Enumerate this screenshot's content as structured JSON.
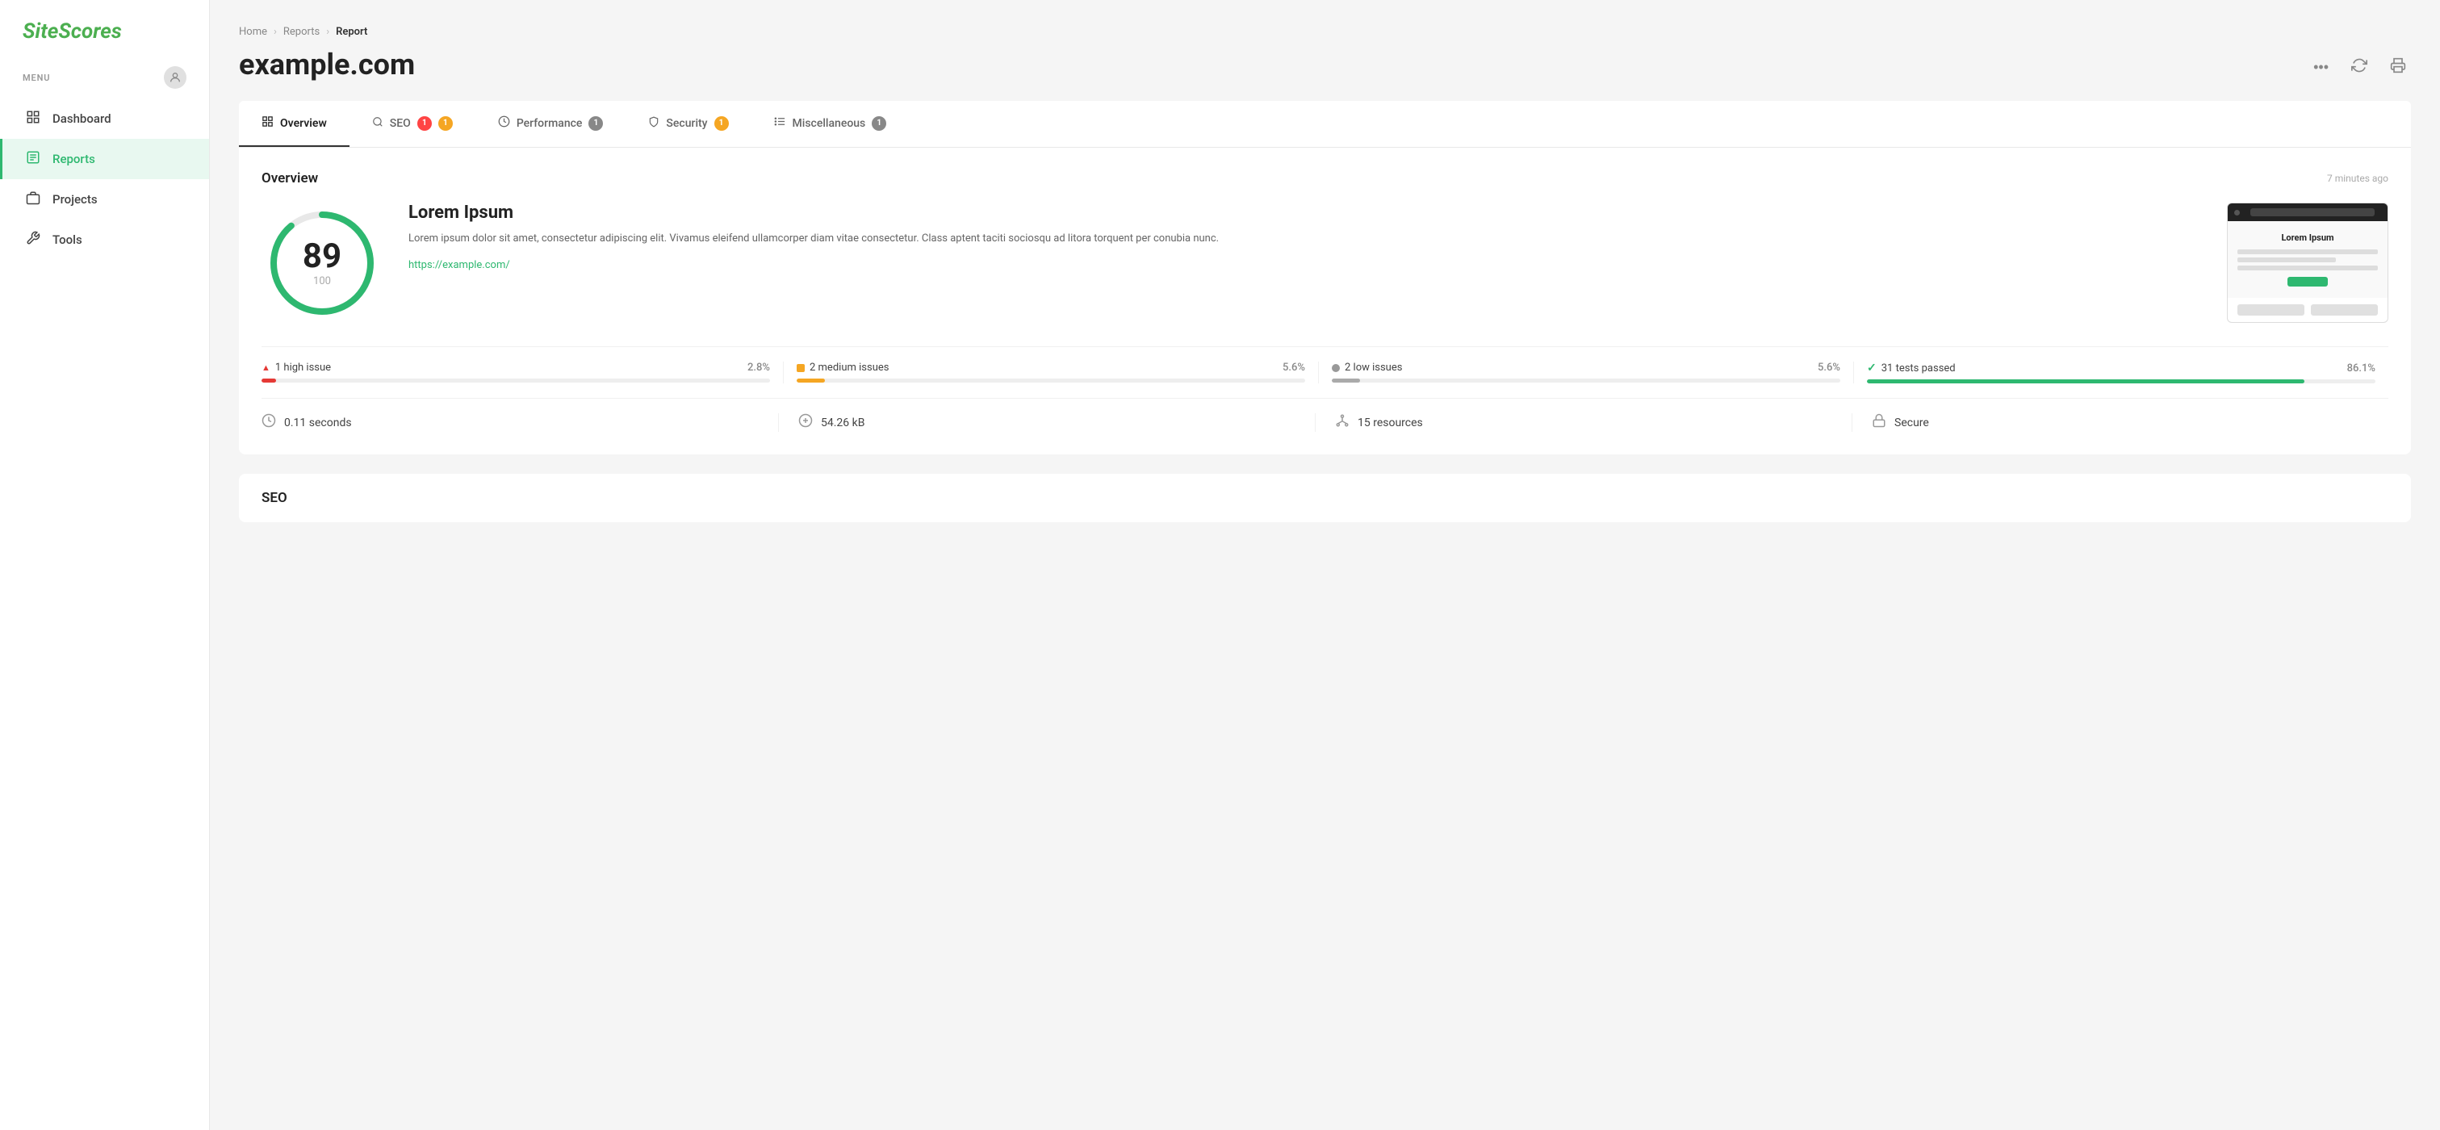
{
  "app": {
    "logo": "SiteScores",
    "menu_label": "MENU"
  },
  "sidebar": {
    "items": [
      {
        "id": "dashboard",
        "label": "Dashboard",
        "icon": "⊞"
      },
      {
        "id": "reports",
        "label": "Reports",
        "icon": "☰",
        "active": true
      },
      {
        "id": "projects",
        "label": "Projects",
        "icon": "◫"
      },
      {
        "id": "tools",
        "label": "Tools",
        "icon": "✂"
      }
    ]
  },
  "breadcrumb": {
    "items": [
      {
        "label": "Home",
        "current": false
      },
      {
        "label": "Reports",
        "current": false
      },
      {
        "label": "Report",
        "current": true
      }
    ]
  },
  "page": {
    "title": "example.com",
    "actions": {
      "more": "•••",
      "refresh": "↻",
      "print": "⎙"
    }
  },
  "tabs": [
    {
      "id": "overview",
      "label": "Overview",
      "icon": "▦",
      "badges": [],
      "active": true
    },
    {
      "id": "seo",
      "label": "SEO",
      "icon": "🔍",
      "badges": [
        {
          "color": "red",
          "count": "1"
        },
        {
          "color": "yellow",
          "count": "1"
        }
      ],
      "active": false
    },
    {
      "id": "performance",
      "label": "Performance",
      "icon": "◎",
      "badges": [
        {
          "color": "neutral",
          "count": "1"
        }
      ],
      "active": false
    },
    {
      "id": "security",
      "label": "Security",
      "icon": "🛡",
      "badges": [
        {
          "color": "yellow",
          "count": "1"
        }
      ],
      "active": false
    },
    {
      "id": "miscellaneous",
      "label": "Miscellaneous",
      "icon": "⊹",
      "badges": [
        {
          "color": "neutral",
          "count": "1"
        }
      ],
      "active": false
    }
  ],
  "overview": {
    "title": "Overview",
    "timestamp": "7 minutes ago",
    "score": {
      "value": 89,
      "max": 100,
      "percent": 89
    },
    "site": {
      "name": "Lorem Ipsum",
      "description": "Lorem ipsum dolor sit amet, consectetur adipiscing elit. Vivamus eleifend ullamcorper diam vitae consectetur. Class aptent taciti sociosqu ad litora torquent per conubia nunc.",
      "url": "https://example.com/"
    },
    "screenshot": {
      "heading": "Lorem Ipsum",
      "btn_label": ""
    },
    "issues": [
      {
        "id": "high",
        "dot_class": "red",
        "bar_class": "bar-red",
        "label": "1 high issue",
        "pct": "2.8%",
        "fill": 2.8,
        "icon": "▲"
      },
      {
        "id": "medium",
        "dot_class": "yellow",
        "bar_class": "bar-yellow",
        "label": "2 medium issues",
        "pct": "5.6%",
        "fill": 5.6,
        "icon": "■"
      },
      {
        "id": "low",
        "dot_class": "gray",
        "bar_class": "bar-gray",
        "label": "2 low issues",
        "pct": "5.6%",
        "fill": 5.6,
        "icon": "●"
      },
      {
        "id": "passed",
        "dot_class": "green",
        "bar_class": "bar-green",
        "label": "31 tests passed",
        "pct": "86.1%",
        "fill": 86.1,
        "icon": "✓"
      }
    ],
    "stats": [
      {
        "id": "time",
        "icon": "⏱",
        "value": "0.11 seconds"
      },
      {
        "id": "size",
        "icon": "⚖",
        "value": "54.26 kB"
      },
      {
        "id": "resources",
        "icon": "⊛",
        "value": "15 resources"
      },
      {
        "id": "secure",
        "icon": "🔒",
        "value": "Secure"
      }
    ]
  },
  "seo_section": {
    "title": "SEO"
  }
}
